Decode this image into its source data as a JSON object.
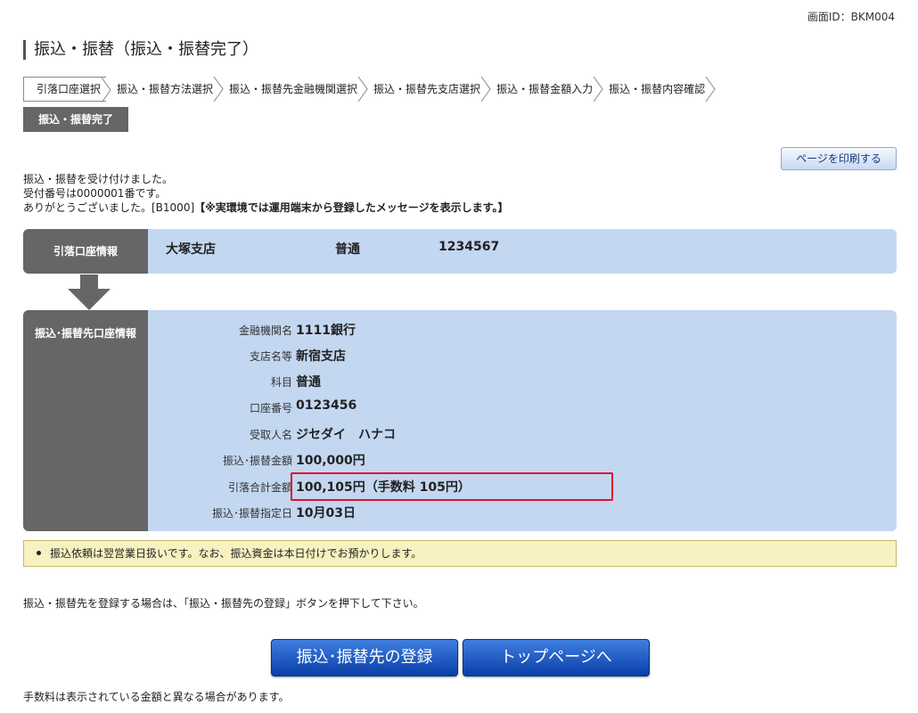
{
  "screen_id": "画面ID：BKM004",
  "page_title": "振込・振替（振込・振替完了）",
  "steps": [
    "引落口座選択",
    "振込・振替方法選択",
    "振込・振替先金融機関選択",
    "振込・振替先支店選択",
    "振込・振替金額入力",
    "振込・振替内容確認"
  ],
  "current_step": "振込・振替完了",
  "print_button": "ページを印刷する",
  "messages": {
    "line1": "振込・振替を受け付けました。",
    "line2": "受付番号は0000001番です。",
    "line3": "ありがとうございました。[B1000]",
    "line3_bold": "【※実環境では運用端末から登録したメッセージを表示します。】"
  },
  "debit_account": {
    "label": "引落口座情報",
    "branch": "大塚支店",
    "type": "普通",
    "number": "1234567"
  },
  "destination": {
    "label": "振込･振替先口座情報",
    "rows": [
      {
        "key": "金融機関名",
        "value": "1111銀行"
      },
      {
        "key": "支店名等",
        "value": "新宿支店"
      },
      {
        "key": "科目",
        "value": "普通"
      },
      {
        "key": "口座番号",
        "value": "0123456"
      },
      {
        "key": "受取人名",
        "value": "ジセダイ　ハナコ"
      },
      {
        "key": "振込･振替金額",
        "value": "100,000円"
      },
      {
        "key": "引落合計金額",
        "value": "100,105円（手数料 105円）"
      },
      {
        "key": "振込･振替指定日",
        "value": "10月03日"
      }
    ]
  },
  "notice": "振込依頼は翌営業日扱いです。なお、振込資金は本日付けでお預かりします。",
  "guide": "振込・振替先を登録する場合は、「振込・振替先の登録」ボタンを押下して下さい。",
  "buttons": {
    "register": "振込･振替先の登録",
    "top": "トップページへ"
  },
  "fee_note": "手数料は表示されている金額と異なる場合があります。",
  "colors": {
    "panel_bg": "#c3d7f1",
    "label_bg": "#666666",
    "highlight": "#e0102a",
    "button": "#0a3ea8"
  }
}
